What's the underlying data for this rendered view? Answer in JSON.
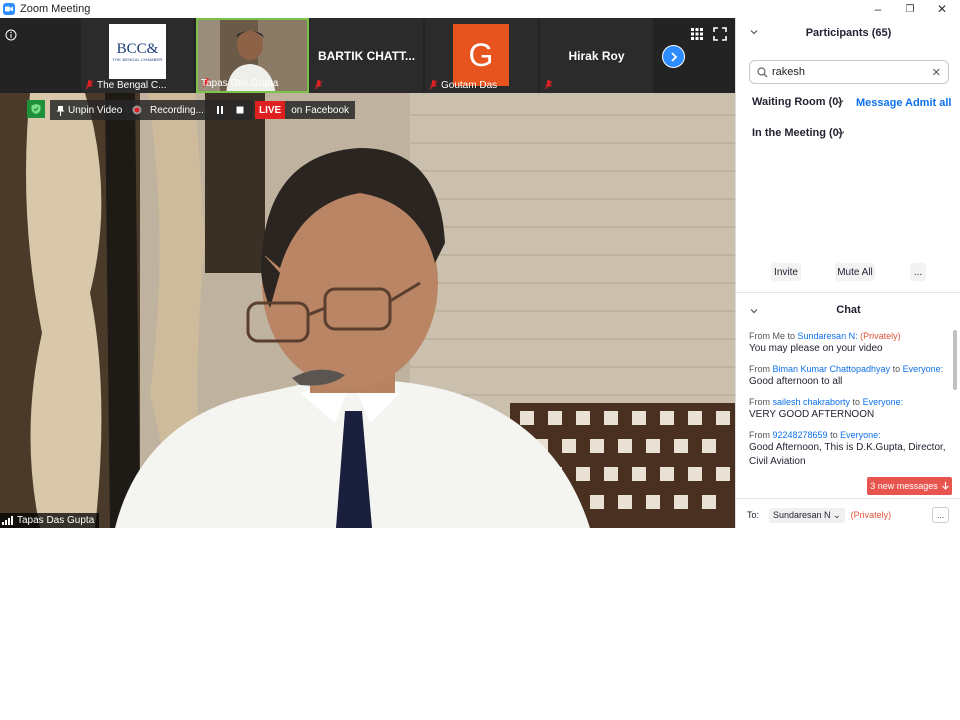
{
  "window": {
    "title": "Zoom Meeting",
    "controls": {
      "minimize": "–",
      "restore": "❐",
      "close": "✕"
    }
  },
  "gallery": {
    "tiles": [
      {
        "name": "The Bengal C...",
        "type": "logo",
        "logo_text": "BCC&",
        "logo_sub": "THE BENGAL CHAMBER"
      },
      {
        "name": "Tapas Das Gupta",
        "type": "video"
      },
      {
        "name": "BARTIK CHATT...",
        "type": "name"
      },
      {
        "name": "Goutam Das",
        "type": "avatar",
        "initial": "G",
        "avatar_color": "#e8541e"
      },
      {
        "name": "Hirak Roy",
        "type": "name"
      }
    ],
    "next_icon": "chevron-right-icon"
  },
  "main_video": {
    "controls": {
      "unpin_label": "Unpin Video",
      "recording_label": "Recording...",
      "live_label": "LIVE",
      "live_target": "on Facebook"
    },
    "speaker_name": "Tapas Das Gupta"
  },
  "participants": {
    "header": "Participants (65)",
    "search_value": "rakesh",
    "waiting_room_label": "Waiting Room (0)",
    "message_label": "Message",
    "admit_all_label": "Admit all",
    "in_meeting_label": "In the Meeting (0)",
    "invite_label": "Invite",
    "mute_all_label": "Mute All",
    "more_label": "..."
  },
  "chat": {
    "header": "Chat",
    "messages": [
      {
        "from": "Me",
        "to": "Sundaresan N:",
        "privately": "(Privately)",
        "text": "You may please on your video"
      },
      {
        "from": "Biman Kumar Chattopadhyay",
        "to": "Everyone:",
        "text": "Good afternoon to all"
      },
      {
        "from": "sailesh chakraborty",
        "to": "Everyone:",
        "text": "VERY GOOD AFTERNOON"
      },
      {
        "from": "92248278659",
        "to": "Everyone:",
        "text": "Good Afternoon, This is D.K.Gupta, Director, Civil Aviation"
      }
    ],
    "new_messages_label": "3 new messages",
    "to_label": "To:",
    "to_value": "Sundaresan N",
    "to_privately": "(Privately)",
    "more_label": "..."
  },
  "colors": {
    "accent": "#0e71eb",
    "live": "#e02020",
    "new_messages": "#e8554e",
    "private": "#e0533a"
  }
}
